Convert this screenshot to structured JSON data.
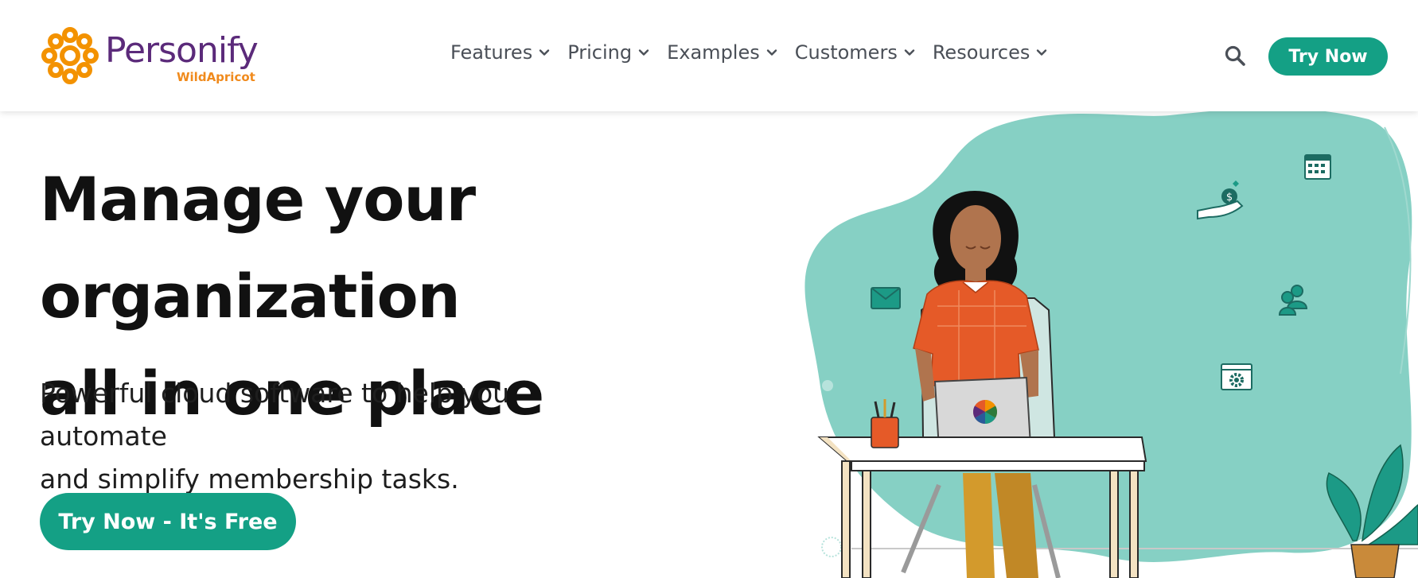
{
  "brand": {
    "name": "Personify",
    "sub": "WildApricot",
    "primary_color": "#5b2a7a",
    "accent_color": "#f08a1c"
  },
  "nav": {
    "items": [
      {
        "label": "Features",
        "icon": "chevron-down-icon"
      },
      {
        "label": "Pricing",
        "icon": "chevron-down-icon"
      },
      {
        "label": "Examples",
        "icon": "chevron-down-icon"
      },
      {
        "label": "Customers",
        "icon": "chevron-down-icon"
      },
      {
        "label": "Resources",
        "icon": "chevron-down-icon"
      }
    ],
    "search_icon": "search-icon"
  },
  "header": {
    "cta_label": "Try Now",
    "cta_color": "#14a085"
  },
  "hero": {
    "title_line1": "Manage your organization",
    "title_line2": "all in one place",
    "subtitle_line1": "Powerful cloud software to help you automate",
    "subtitle_line2": "and simplify membership tasks.",
    "cta_label": "Try Now - It's Free",
    "blob_color": "#86d0c4"
  }
}
